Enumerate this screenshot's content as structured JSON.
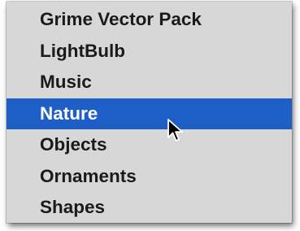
{
  "menu": {
    "items": [
      {
        "label": "Grime Vector Pack",
        "selected": false
      },
      {
        "label": "LightBulb",
        "selected": false
      },
      {
        "label": "Music",
        "selected": false
      },
      {
        "label": "Nature",
        "selected": true
      },
      {
        "label": "Objects",
        "selected": false
      },
      {
        "label": "Ornaments",
        "selected": false
      },
      {
        "label": "Shapes",
        "selected": false
      }
    ],
    "selected_label": "Nature"
  },
  "colors": {
    "menu_background": "#d7d7d7",
    "selection_highlight": "#1d5fc6",
    "text": "#1a1a1a",
    "selected_text": "#ffffff"
  },
  "icons": {
    "pointer": "arrow-cursor-icon"
  }
}
